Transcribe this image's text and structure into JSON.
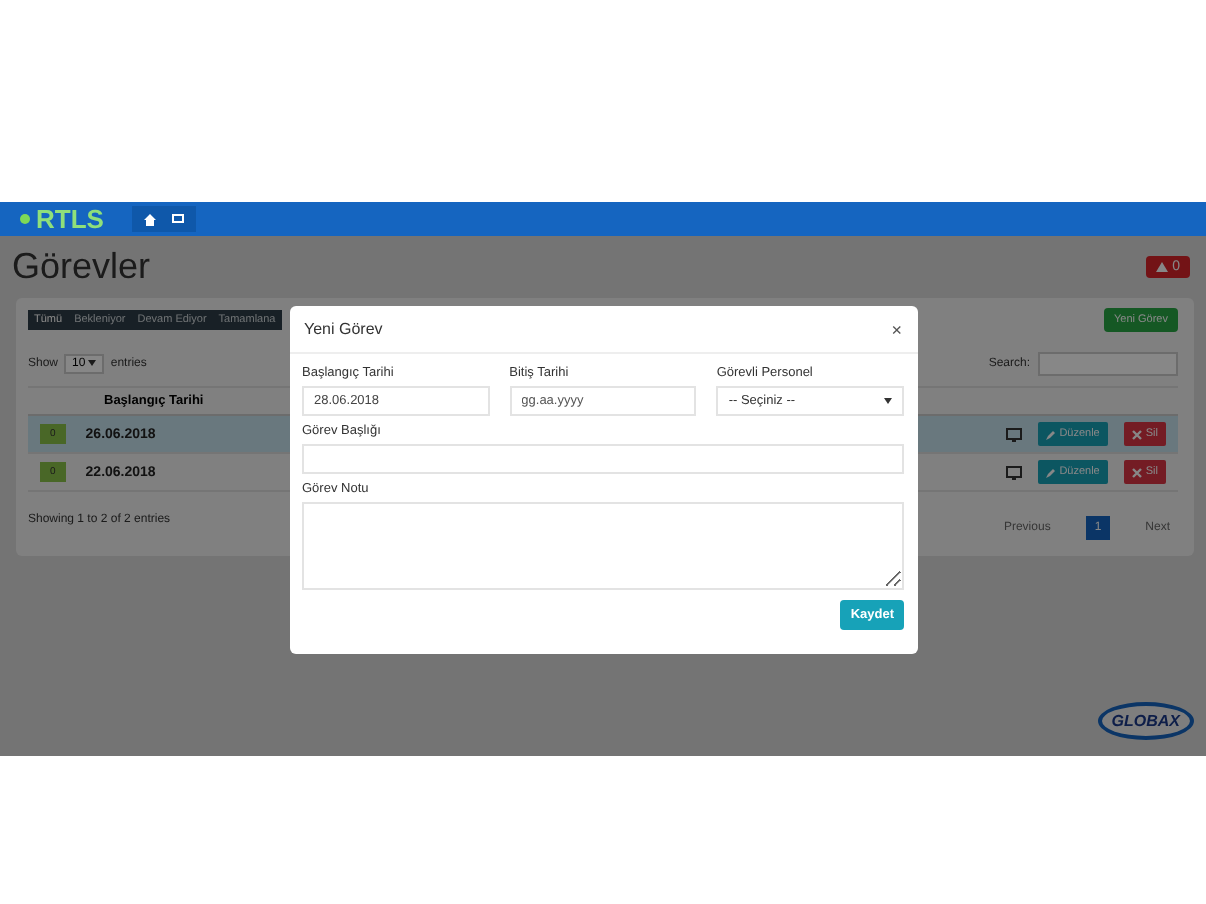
{
  "brand": "RTLS",
  "page_title": "Görevler",
  "alert_badge": "0",
  "filter_tabs": [
    "Tümü",
    "Bekleniyor",
    "Devam Ediyor",
    "Tamamlana"
  ],
  "new_button": "Yeni Görev",
  "length": {
    "before": "Show",
    "value": "10",
    "after": "entries"
  },
  "search_label": "Search:",
  "table": {
    "columns": [
      "Başlangıç Tarihi"
    ],
    "rows": [
      {
        "badge": "0",
        "date": "26.06.2018",
        "selected": true,
        "edit": "Düzenle",
        "delete": "Sil"
      },
      {
        "badge": "0",
        "date": "22.06.2018",
        "selected": false,
        "edit": "Düzenle",
        "delete": "Sil"
      }
    ]
  },
  "info": "Showing 1 to 2 of 2 entries",
  "pagination": {
    "previous": "Previous",
    "pages": [
      {
        "label": "1",
        "selected": true
      }
    ],
    "next": "Next"
  },
  "logo": "GLOBAX",
  "modal": {
    "title": "Yeni Görev",
    "close": "×",
    "start": {
      "label": "Başlangıç Tarihi",
      "value": "28.06.2018"
    },
    "end": {
      "label": "Bitiş Tarihi",
      "placeholder": "gg.aa.yyyy"
    },
    "staff": {
      "label": "Görevli Personel",
      "value": "-- Seçiniz --"
    },
    "subject": {
      "label": "Görev Başlığı"
    },
    "note": {
      "label": "Görev Notu"
    },
    "submit": "Kaydet"
  }
}
